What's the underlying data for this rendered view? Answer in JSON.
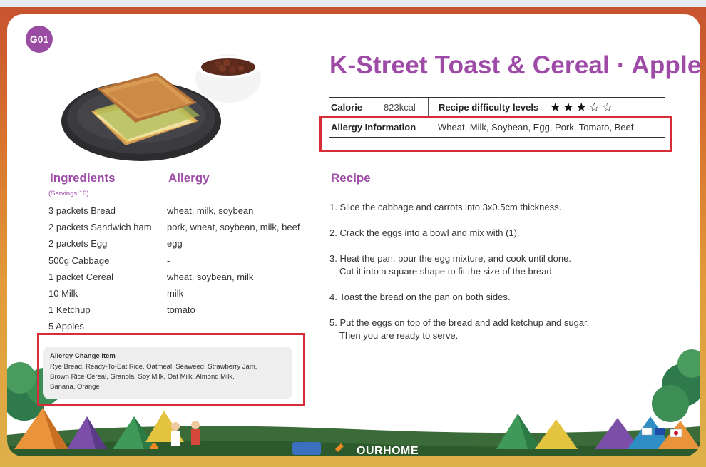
{
  "badge": "G01",
  "title": "K-Street Toast & Cereal · Apple",
  "info": {
    "calorie_label": "Calorie",
    "calorie_value": "823kcal",
    "difficulty_label": "Recipe difficulty levels",
    "difficulty_rating": 3,
    "difficulty_max": 5,
    "allergy_label": "Allergy Information",
    "allergy_value": "Wheat, Milk, Soybean, Egg, Pork, Tomato, Beef"
  },
  "ingredients_heading": "Ingredients",
  "servings": "(Servings 10)",
  "allergy_heading": "Allergy",
  "ingredients": [
    {
      "item": "3 packets Bread",
      "allergy": "wheat, milk, soybean"
    },
    {
      "item": "2 packets Sandwich ham",
      "allergy": "pork, wheat, soybean, milk, beef"
    },
    {
      "item": "2 packets Egg",
      "allergy": "egg"
    },
    {
      "item": "500g Cabbage",
      "allergy": "-"
    },
    {
      "item": "1 packet Cereal",
      "allergy": "wheat, soybean, milk"
    },
    {
      "item": "10 Milk",
      "allergy": "milk"
    },
    {
      "item": "1 Ketchup",
      "allergy": "tomato"
    },
    {
      "item": "5 Apples",
      "allergy": "-"
    }
  ],
  "recipe_heading": "Recipe",
  "recipe_steps": [
    {
      "line1": "1. Slice the cabbage and carrots into 3x0.5cm thickness.",
      "line2": ""
    },
    {
      "line1": "2. Crack the eggs into a bowl and mix with (1).",
      "line2": ""
    },
    {
      "line1": "3. Heat the pan, pour the egg mixture, and cook until done.",
      "line2": "Cut it into a square shape to fit the size of the bread."
    },
    {
      "line1": "4. Toast the bread on the pan on both sides.",
      "line2": ""
    },
    {
      "line1": "5. Put the eggs on top of the bread and add ketchup and sugar.",
      "line2": "Then you are ready to serve."
    }
  ],
  "allergy_change": {
    "title": "Allergy Change Item",
    "lines": [
      "Rye Bread, Ready-To-Eat Rice, Oatmeal, Seaweed, Strawberry Jam,",
      "Brown Rice Cereal, Granola, Soy Milk, Oat Milk, Almond Milk,",
      "Banana, Orange"
    ]
  },
  "footer_logo": "OURHOME",
  "colors": {
    "accent": "#9e4aa7",
    "highlight": "#ecc6e8",
    "alert_box": "#d52e3a"
  }
}
